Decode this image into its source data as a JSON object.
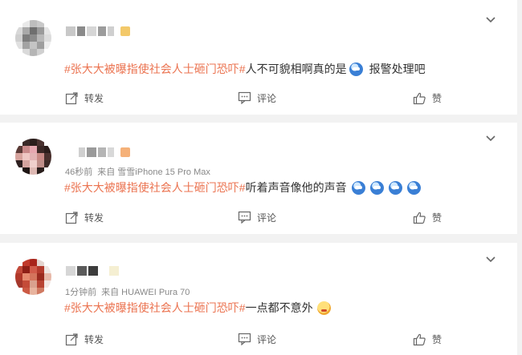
{
  "comments": [
    {
      "time": "",
      "source": "",
      "topic": "#张大大被曝指使社会人士砸门恐吓#",
      "text": "人不可貌相啊真的是",
      "text_after": "报警处理吧",
      "emojis": [
        "doge-blue-emoji"
      ],
      "actions": {
        "forward": "转发",
        "comment": "评论",
        "like": "赞"
      }
    },
    {
      "time": "46秒前",
      "source": "来自 雪雪iPhone 15 Pro Max",
      "topic": "#张大大被曝指使社会人士砸门恐吓#",
      "text": "听着声音像他的声音",
      "text_after": "",
      "emojis": [
        "doge-blue-emoji",
        "doge-blue-emoji",
        "doge-blue-emoji",
        "doge-blue-emoji"
      ],
      "actions": {
        "forward": "转发",
        "comment": "评论",
        "like": "赞"
      }
    },
    {
      "time": "1分钟前",
      "source": "来自 HUAWEI Pura 70",
      "topic": "#张大大被曝指使社会人士砸门恐吓#",
      "text": "一点都不意外",
      "text_after": "",
      "emojis": [
        "thinking-yellow-emoji"
      ],
      "actions": {
        "forward": "转发",
        "comment": "评论",
        "like": "赞"
      }
    }
  ],
  "colors": {
    "topic": "#eb7350",
    "background": "#f2f2f2",
    "card": "#ffffff",
    "meta": "#888888"
  },
  "icons": [
    "forward-icon",
    "comment-icon",
    "like-icon",
    "chevron-down-icon"
  ]
}
